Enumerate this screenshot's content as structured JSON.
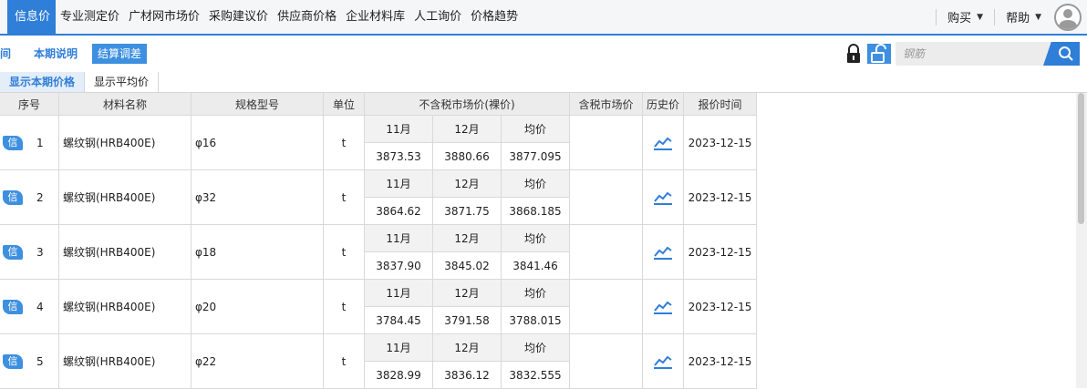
{
  "nav": {
    "tabs": [
      "信息价",
      "专业测定价",
      "广材网市场价",
      "采购建议价",
      "供应商价格",
      "企业材料库",
      "人工询价",
      "价格趋势"
    ],
    "active_index": 0,
    "buy_label": "购买",
    "help_label": "帮助"
  },
  "toolbar": {
    "partial_label": "间",
    "notes_label": "本期说明",
    "settle_label": "结算调差"
  },
  "search": {
    "placeholder": "钢筋"
  },
  "subtabs": {
    "current_label": "显示本期价格",
    "average_label": "显示平均价"
  },
  "table": {
    "headers": {
      "seq": "序号",
      "name": "材料名称",
      "spec": "规格型号",
      "unit": "单位",
      "ex_tax": "不含税市场价(裸价)",
      "inc_tax": "含税市场价",
      "history": "历史价",
      "time": "报价时间"
    },
    "sub_headers": {
      "m1": "11月",
      "m2": "12月",
      "avg": "均价"
    },
    "badge": "信",
    "rows": [
      {
        "seq": "1",
        "name": "螺纹钢(HRB400E)",
        "spec": "φ16",
        "unit": "t",
        "m1": "3873.53",
        "m2": "3880.66",
        "avg": "3877.095",
        "inc": "",
        "time": "2023-12-15"
      },
      {
        "seq": "2",
        "name": "螺纹钢(HRB400E)",
        "spec": "φ32",
        "unit": "t",
        "m1": "3864.62",
        "m2": "3871.75",
        "avg": "3868.185",
        "inc": "",
        "time": "2023-12-15"
      },
      {
        "seq": "3",
        "name": "螺纹钢(HRB400E)",
        "spec": "φ18",
        "unit": "t",
        "m1": "3837.90",
        "m2": "3845.02",
        "avg": "3841.46",
        "inc": "",
        "time": "2023-12-15"
      },
      {
        "seq": "4",
        "name": "螺纹钢(HRB400E)",
        "spec": "φ20",
        "unit": "t",
        "m1": "3784.45",
        "m2": "3791.58",
        "avg": "3788.015",
        "inc": "",
        "time": "2023-12-15"
      },
      {
        "seq": "5",
        "name": "螺纹钢(HRB400E)",
        "spec": "φ22",
        "unit": "t",
        "m1": "3828.99",
        "m2": "3836.12",
        "avg": "3832.555",
        "inc": "",
        "time": "2023-12-15"
      }
    ]
  },
  "colors": {
    "accent": "#2f7ed8",
    "badge": "#3d8fe0",
    "header_bg": "#ececec"
  }
}
